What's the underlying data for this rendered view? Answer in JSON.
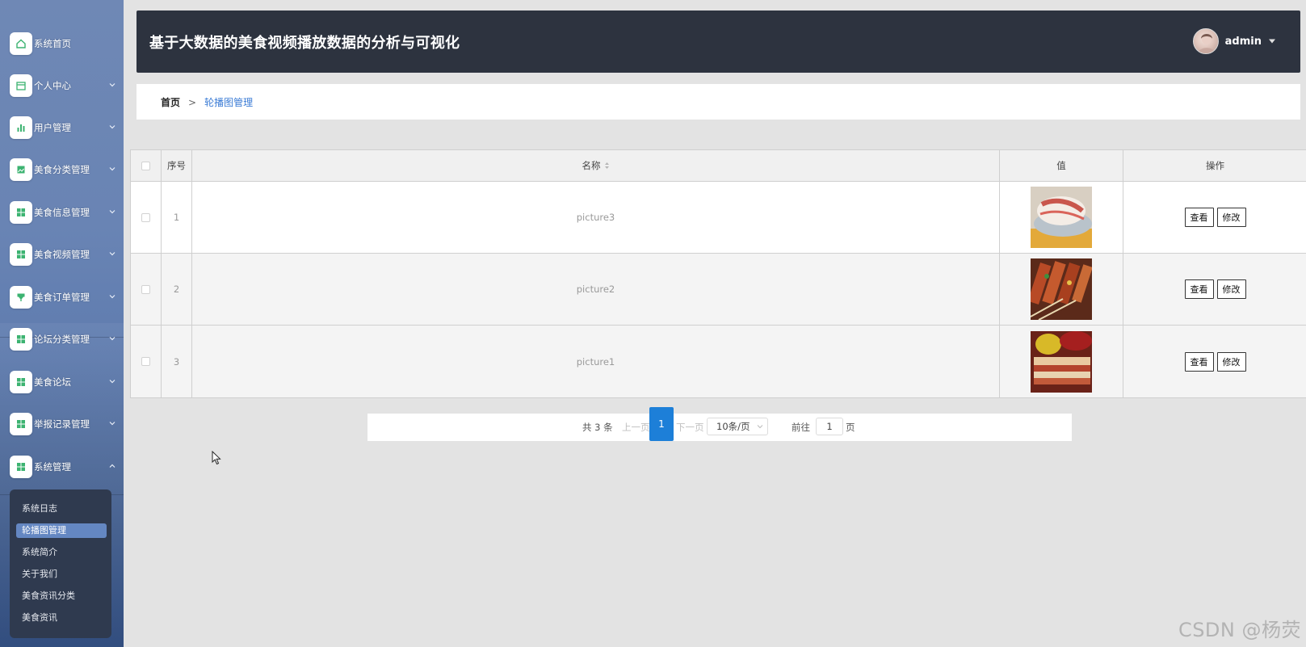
{
  "header": {
    "title": "基于大数据的美食视频播放数据的分析与可视化",
    "user": "admin"
  },
  "sidebar": {
    "items": [
      {
        "label": "系统首页",
        "icon": "home-icon"
      },
      {
        "label": "个人中心",
        "icon": "calendar-icon"
      },
      {
        "label": "用户管理",
        "icon": "bar-chart-icon"
      },
      {
        "label": "美食分类管理",
        "icon": "image-icon"
      },
      {
        "label": "美食信息管理",
        "icon": "grid-icon"
      },
      {
        "label": "美食视频管理",
        "icon": "grid-icon"
      },
      {
        "label": "美食订单管理",
        "icon": "cup-icon"
      },
      {
        "label": "论坛分类管理",
        "icon": "grid-icon"
      },
      {
        "label": "美食论坛",
        "icon": "grid-icon"
      },
      {
        "label": "举报记录管理",
        "icon": "grid-icon"
      },
      {
        "label": "系统管理",
        "icon": "grid-icon"
      }
    ],
    "submenu": [
      "系统日志",
      "轮播图管理",
      "系统简介",
      "关于我们",
      "美食资讯分类",
      "美食资讯"
    ]
  },
  "breadcrumb": {
    "home": "首页",
    "separator": ">",
    "current": "轮播图管理"
  },
  "table": {
    "headers": {
      "index": "序号",
      "name": "名称",
      "value": "值",
      "actions": "操作"
    },
    "rows": [
      {
        "index": "1",
        "name": "picture3",
        "view": "查看",
        "edit": "修改"
      },
      {
        "index": "2",
        "name": "picture2",
        "view": "查看",
        "edit": "修改"
      },
      {
        "index": "3",
        "name": "picture1",
        "view": "查看",
        "edit": "修改"
      }
    ]
  },
  "pagination": {
    "total": "共 3 条",
    "prev": "上一页",
    "current": "1",
    "next": "下一页",
    "page_size": "10条/页",
    "goto": "前往",
    "goto_value": "1",
    "unit": "页"
  },
  "watermark": "CSDN @杨荧",
  "colors": {
    "header_bg": "#2d333f",
    "accent": "#1d7fd8",
    "icon_green": "#3cb371",
    "submenu_bg": "#2f3a4f",
    "submenu_active": "#6487c2"
  }
}
